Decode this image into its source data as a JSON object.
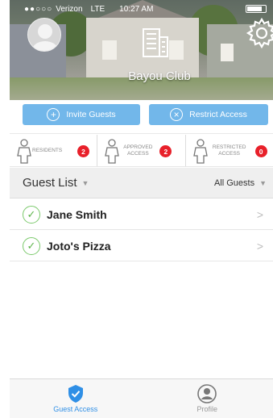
{
  "status_bar": {
    "signal": "●●○○○",
    "carrier": "Verizon",
    "network": "LTE",
    "time": "10:27 AM"
  },
  "header": {
    "club_name": "Bayou Club"
  },
  "actions": {
    "invite_label": "Invite Guests",
    "restrict_label": "Restrict Access"
  },
  "stats": [
    {
      "label": "RESIDENTS",
      "count": "2"
    },
    {
      "label": "APPROVED ACCESS",
      "count": "2"
    },
    {
      "label": "RESTRICTED ACCESS",
      "count": "0"
    }
  ],
  "guest_list": {
    "title": "Guest List",
    "filter": "All Guests",
    "guests": [
      {
        "name": "Jane Smith"
      },
      {
        "name": "Joto's Pizza"
      }
    ]
  },
  "tabs": [
    {
      "label": "Guest Access",
      "icon": "shield-icon",
      "active": true
    },
    {
      "label": "Profile",
      "icon": "user-icon",
      "active": false
    }
  ],
  "colors": {
    "accent": "#2f8fe6",
    "button": "#72b7ea",
    "badge": "#e8202a",
    "check": "#7bc96b"
  }
}
